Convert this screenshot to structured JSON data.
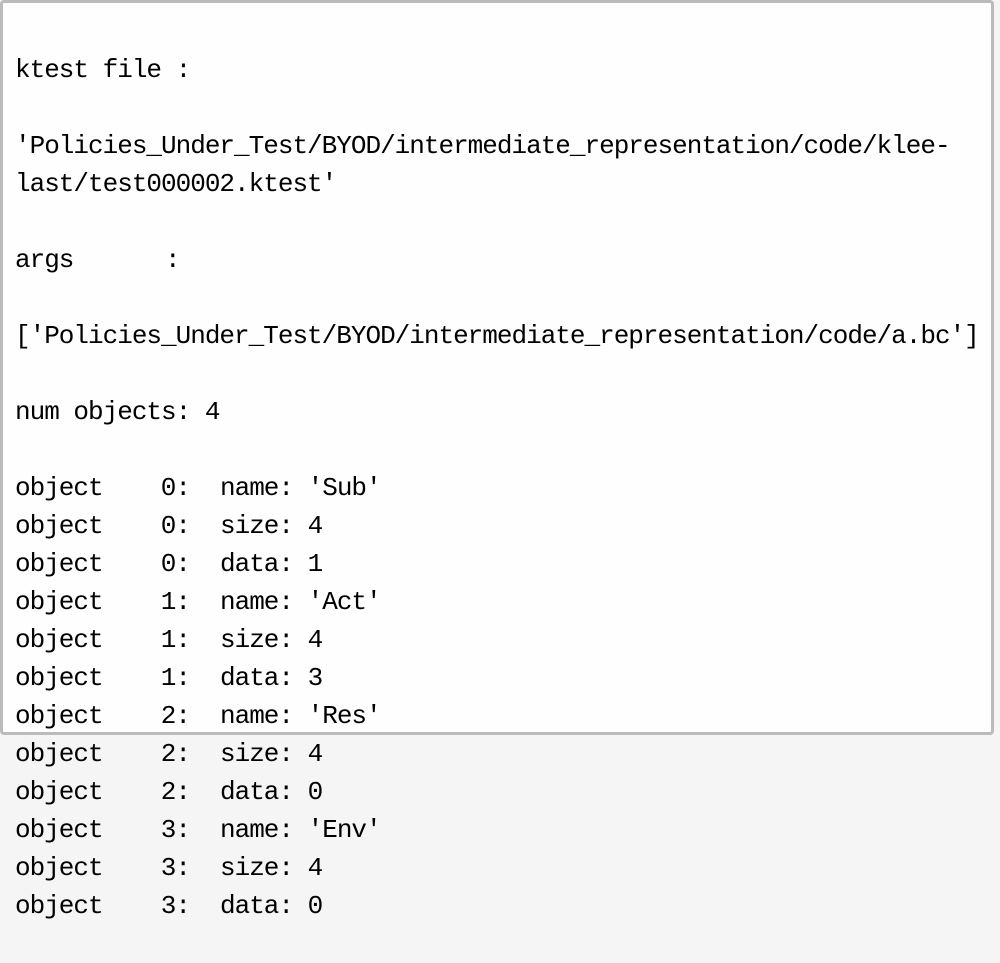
{
  "header": {
    "ktest_label": "ktest file :",
    "ktest_path": "'Policies_Under_Test/BYOD/intermediate_representation/code/klee-last/test000002.ktest'",
    "args_label": "args",
    "args_value": "['Policies_Under_Test/BYOD/intermediate_representation/code/a.bc']",
    "num_objects_label": "num objects:",
    "num_objects_value": "4"
  },
  "objects": [
    {
      "index": "0",
      "name": "'Sub'",
      "size": "4",
      "data": "1"
    },
    {
      "index": "1",
      "name": "'Act'",
      "size": "4",
      "data": "3"
    },
    {
      "index": "2",
      "name": "'Res'",
      "size": "4",
      "data": "0"
    },
    {
      "index": "3",
      "name": "'Env'",
      "size": "4",
      "data": "0"
    }
  ]
}
